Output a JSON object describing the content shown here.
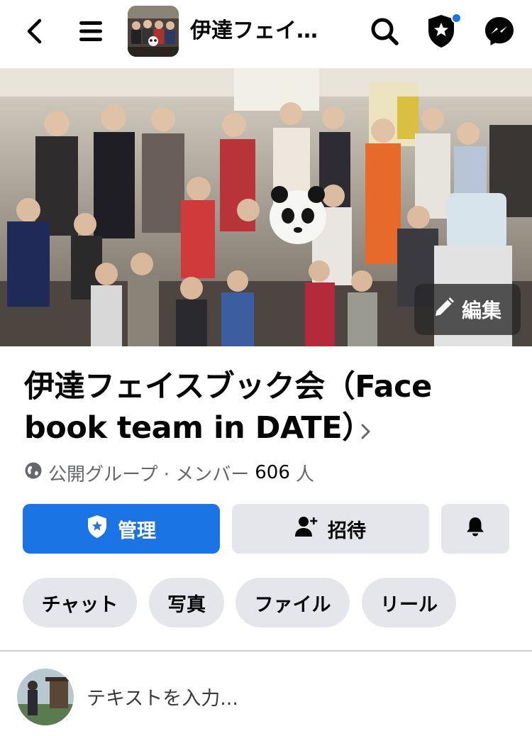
{
  "header": {
    "title": "伊達フェイ…",
    "icons": [
      "back-arrow-icon",
      "hamburger-menu-icon",
      "search-icon",
      "admin-shield-icon",
      "messenger-icon"
    ]
  },
  "cover": {
    "edit_label": "編集"
  },
  "group": {
    "name": "伊達フェイスブック会（Face book team in DATE）",
    "privacy": "公開グループ · メンバー",
    "member_count": "606",
    "member_unit": "人"
  },
  "actions": {
    "manage_label": "管理",
    "invite_label": "招待"
  },
  "tabs": [
    "チャット",
    "写真",
    "ファイル",
    "リール"
  ],
  "composer": {
    "placeholder": "テキストを入力..."
  },
  "colors": {
    "accent": "#1b74e4",
    "button_gray": "#e4e6eb",
    "secondary_text": "#65676b"
  }
}
